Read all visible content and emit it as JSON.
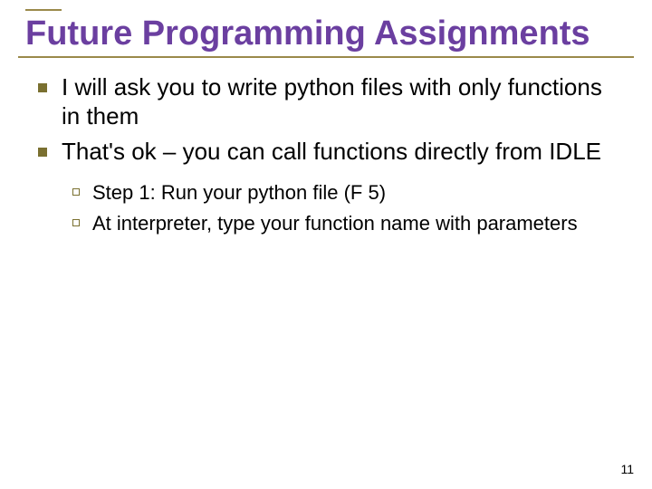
{
  "title": "Future Programming Assignments",
  "bullets": [
    "I will ask you to write python files with only functions in them",
    "That's ok – you can call functions directly from IDLE"
  ],
  "subbullets": [
    "Step 1: Run your python file (F 5)",
    "At interpreter, type your function name with parameters"
  ],
  "page_number": "11"
}
